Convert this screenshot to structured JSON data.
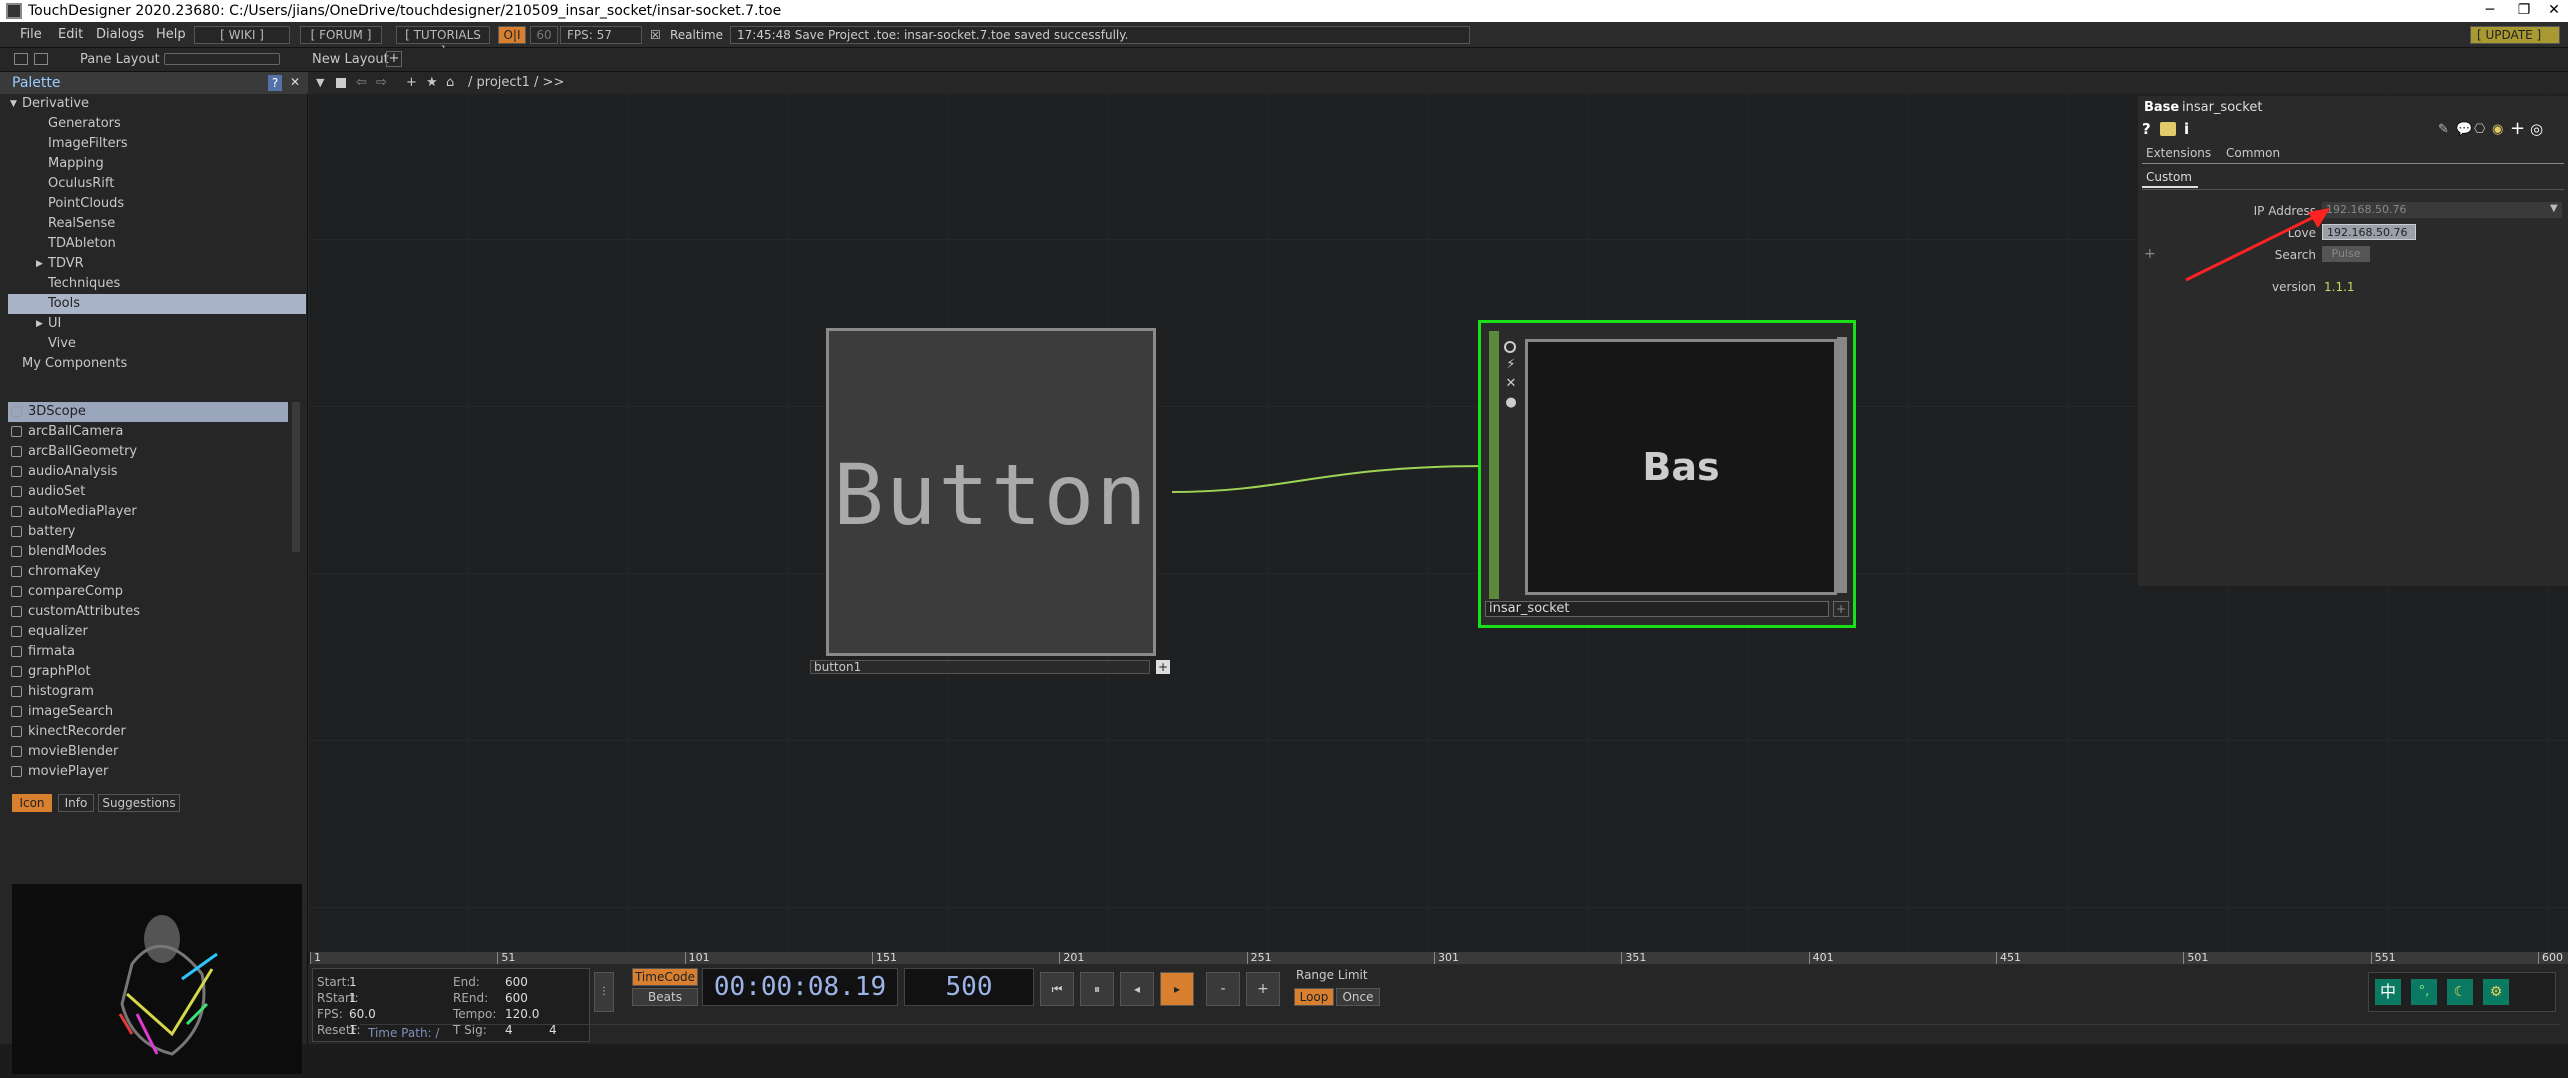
{
  "window": {
    "title": "TouchDesigner 2020.23680: C:/Users/jians/OneDrive/touchdesigner/210509_insar_socket/insar-socket.7.toe",
    "minimize": "─",
    "restore": "❐",
    "close": "✕"
  },
  "menu": {
    "items": [
      "File",
      "Edit",
      "Dialogs",
      "Help"
    ],
    "wiki": "[ WIKI ]",
    "forum": "[ FORUM ]",
    "tutorials": "[ TUTORIALS ]",
    "oi": "O|I",
    "fps_cap": "60",
    "fps": "FPS:  57",
    "realtime": "Realtime",
    "status": "17:45:48 Save Project .toe: insar-socket.7.toe saved successfully.",
    "update": "[ UPDATE ]"
  },
  "toolbar": {
    "pane_layout": "Pane Layout",
    "new_layout": "New Layout",
    "plus": "+"
  },
  "palette": {
    "title": "Palette",
    "help": "?",
    "close": "✕",
    "tree": [
      {
        "label": "Derivative",
        "indent": 0,
        "arrow": "▼"
      },
      {
        "label": "Generators",
        "indent": 1
      },
      {
        "label": "ImageFilters",
        "indent": 1
      },
      {
        "label": "Mapping",
        "indent": 1
      },
      {
        "label": "OculusRift",
        "indent": 1
      },
      {
        "label": "PointClouds",
        "indent": 1
      },
      {
        "label": "RealSense",
        "indent": 1
      },
      {
        "label": "TDAbleton",
        "indent": 1
      },
      {
        "label": "TDVR",
        "indent": 1,
        "arrow": "▶"
      },
      {
        "label": "Techniques",
        "indent": 1
      },
      {
        "label": "Tools",
        "indent": 1,
        "selected": true
      },
      {
        "label": "UI",
        "indent": 1,
        "arrow": "▶"
      },
      {
        "label": "Vive",
        "indent": 1
      },
      {
        "label": "My Components",
        "indent": 0
      }
    ],
    "items": [
      "3DScope",
      "arcBallCamera",
      "arcBallGeometry",
      "audioAnalysis",
      "audioSet",
      "autoMediaPlayer",
      "battery",
      "blendModes",
      "chromaKey",
      "compareComp",
      "customAttributes",
      "equalizer",
      "firmata",
      "graphPlot",
      "histogram",
      "imageSearch",
      "kinectRecorder",
      "movieBlender",
      "moviePlayer"
    ],
    "tabs": [
      "Icon",
      "Info",
      "Suggestions"
    ]
  },
  "network": {
    "path": "/ project1 / >>",
    "button_node": {
      "display": "Button",
      "name": "button1"
    },
    "base_node": {
      "display": "Bas",
      "name": "insar_socket"
    }
  },
  "params": {
    "type": "Base",
    "name": "insar_socket",
    "tabs": [
      "Extensions",
      "Common"
    ],
    "page": "Custom",
    "rows": [
      {
        "label": "IP Address",
        "value": "192.168.50.76"
      },
      {
        "label": "Love",
        "value": "192.168.50.76"
      },
      {
        "label": "Search",
        "value": "Pulse"
      },
      {
        "label": "version",
        "value": "1.1.1"
      }
    ],
    "add": "+"
  },
  "timeline": {
    "ticks": [
      "1",
      "51",
      "101",
      "151",
      "201",
      "251",
      "301",
      "351",
      "401",
      "451",
      "501",
      "551",
      "600"
    ]
  },
  "transport": {
    "start_label": "Start:",
    "start": "1",
    "end_label": "End:",
    "end": "600",
    "rstart_label": "RStart:",
    "rstart": "1",
    "rend_label": "REnd:",
    "rend": "600",
    "fps_label": "FPS:",
    "fps": "60.0",
    "tempo_label": "Tempo:",
    "tempo": "120.0",
    "resetf_label": "ResetF:",
    "resetf": "1",
    "tsig_label": "T Sig:",
    "tsig_a": "4",
    "tsig_b": "4",
    "timecode": "TimeCode",
    "beats": "Beats",
    "time": "00:00:08.19",
    "frame": "500",
    "range_limit": "Range Limit",
    "loop": "Loop",
    "once": "Once",
    "time_path": "Time Path: /"
  },
  "tray": {
    "ime": "中"
  },
  "colors": {
    "accent": "#d88030",
    "selection_green": "#19e019",
    "link": "#9fd356"
  }
}
